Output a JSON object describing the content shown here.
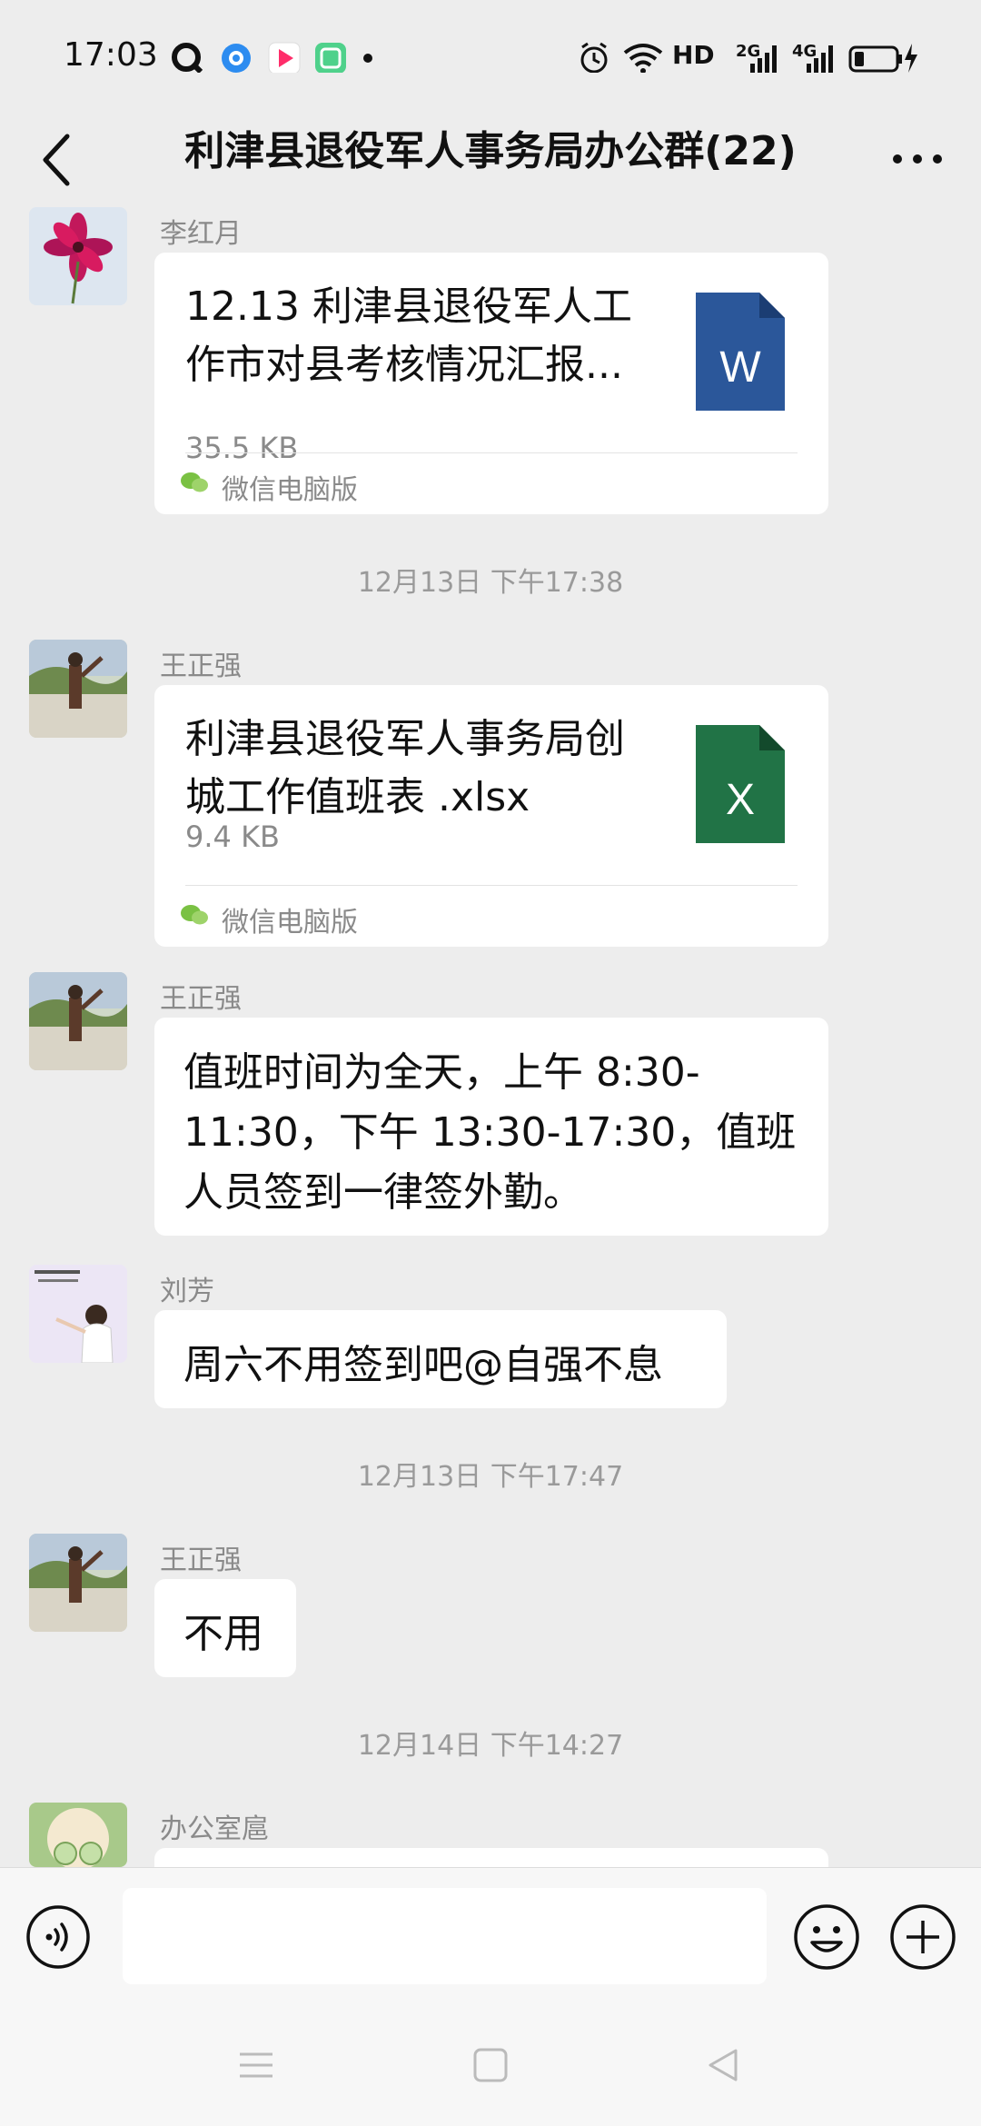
{
  "status_bar": {
    "time": "17:03",
    "network": "HD",
    "signal_2g": "2G",
    "signal_4g": "4G",
    "app_icons": [
      "q-icon",
      "circle-app-icon",
      "youku-icon",
      "green-app-icon"
    ]
  },
  "header": {
    "title": "利津县退役军人事务局办公群(22)"
  },
  "messages": [
    {
      "sender": "李红月",
      "file": {
        "name": "12.13 利津县退役军人工作市对县考核情况汇报...",
        "size": "35.5 KB",
        "type": "W",
        "source": "微信电脑版"
      }
    },
    {
      "timestamp": "12月13日 下午17:38"
    },
    {
      "sender": "王正强",
      "file": {
        "name": "利津县退役军人事务局创城工作值班表 .xlsx",
        "size": "9.4 KB",
        "type": "X",
        "source": "微信电脑版"
      }
    },
    {
      "sender": "王正强",
      "text": "值班时间为全天，上午 8:30-11:30，下午 13:30-17:30，值班人员签到一律签外勤。"
    },
    {
      "sender": "刘芳",
      "text": "周六不用签到吧@自强不息"
    },
    {
      "timestamp": "12月13日 下午17:47"
    },
    {
      "sender": "王正强",
      "text": "不用"
    },
    {
      "timestamp": "12月14日 下午14:27"
    },
    {
      "sender": "办公室扈"
    }
  ],
  "colors": {
    "background": "#ededed",
    "word_blue": "#2b579a",
    "excel_green": "#217346",
    "wechat_green": "#7ac143"
  }
}
